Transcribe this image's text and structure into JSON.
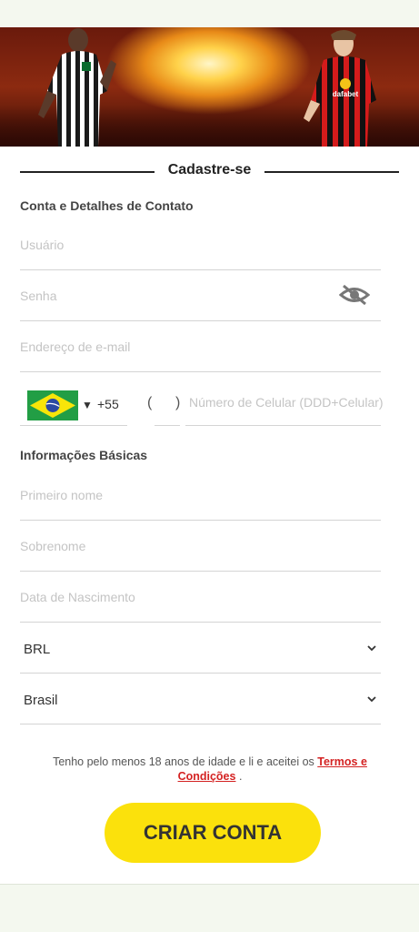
{
  "form": {
    "title": "Cadastre-se",
    "section_contact": "Conta e Detalhes de Contato",
    "username_placeholder": "Usuário",
    "password_placeholder": "Senha",
    "email_placeholder": "Endereço de e-mail",
    "phone": {
      "country_code": "+55",
      "ddd_open": "(",
      "ddd_close": ")",
      "number_placeholder": "Número de Celular (DDD+Celular)"
    },
    "section_basic": "Informações Básicas",
    "first_name_placeholder": "Primeiro nome",
    "last_name_placeholder": "Sobrenome",
    "birthdate_placeholder": "Data de Nascimento",
    "currency_value": "BRL",
    "country_value": "Brasil",
    "terms_text": "Tenho pelo menos 18 anos de idade e li e aceitei os ",
    "terms_link": "Termos e Condições",
    "terms_end": " .",
    "submit_label": "CRIAR CONTA"
  },
  "banner": {
    "sponsor_text": "dafabet"
  },
  "icons": {
    "password_toggle": "eye-slash-icon",
    "country_flag": "brazil-flag-icon",
    "dropdown": "chevron-down-icon"
  },
  "colors": {
    "accent_button": "#fbe10c",
    "link": "#d42222",
    "background": "#f4f8ef"
  }
}
